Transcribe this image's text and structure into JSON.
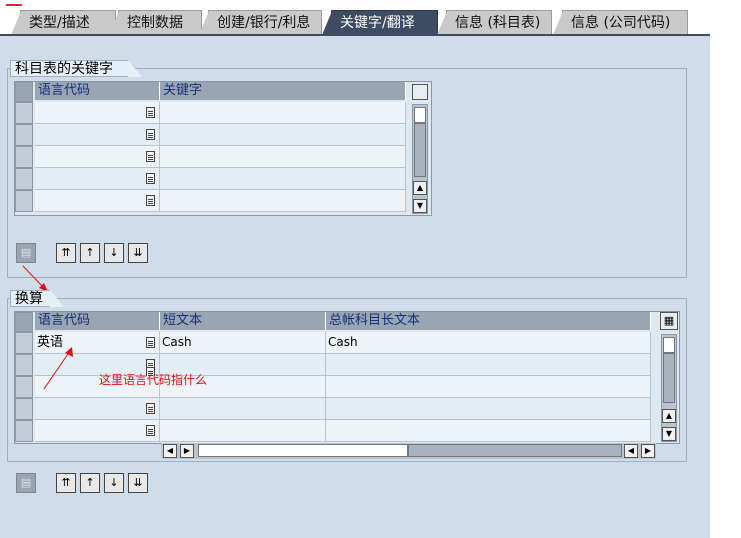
{
  "tabs": [
    {
      "label": "类型/描述",
      "active": false
    },
    {
      "label": "控制数据",
      "active": false
    },
    {
      "label": "创建/银行/利息",
      "active": false
    },
    {
      "label": "关键字/翻译",
      "active": true
    },
    {
      "label": "信息 (科目表)",
      "active": false
    },
    {
      "label": "信息 (公司代码)",
      "active": false
    }
  ],
  "keywords_group": {
    "title": "科目表的关键字",
    "columns": [
      "语言代码",
      "关键字"
    ],
    "rows": [
      [
        "",
        ""
      ],
      [
        "",
        ""
      ],
      [
        "",
        ""
      ],
      [
        "",
        ""
      ],
      [
        "",
        ""
      ]
    ]
  },
  "translation_group": {
    "title": "换算",
    "columns": [
      "语言代码",
      "短文本",
      "总帐科目长文本"
    ],
    "rows": [
      [
        "英语",
        "Cash",
        "Cash"
      ],
      [
        "",
        "",
        ""
      ],
      [
        "",
        "",
        ""
      ],
      [
        "",
        "",
        ""
      ],
      [
        "",
        "",
        ""
      ]
    ]
  },
  "annotation": "这里语言代码指什么",
  "icons": {
    "table_settings": "table-settings-icon",
    "value_help": "value-help-icon",
    "scroll_top": "scroll-first-page-icon",
    "scroll_up": "scroll-page-up-icon",
    "scroll_down": "scroll-page-down-icon",
    "scroll_bottom": "scroll-last-page-icon"
  },
  "colors": {
    "active_tab": "#3d4b63",
    "background": "#cfdcea",
    "header": "#9aa5b3",
    "annotation": "#dd1111"
  }
}
